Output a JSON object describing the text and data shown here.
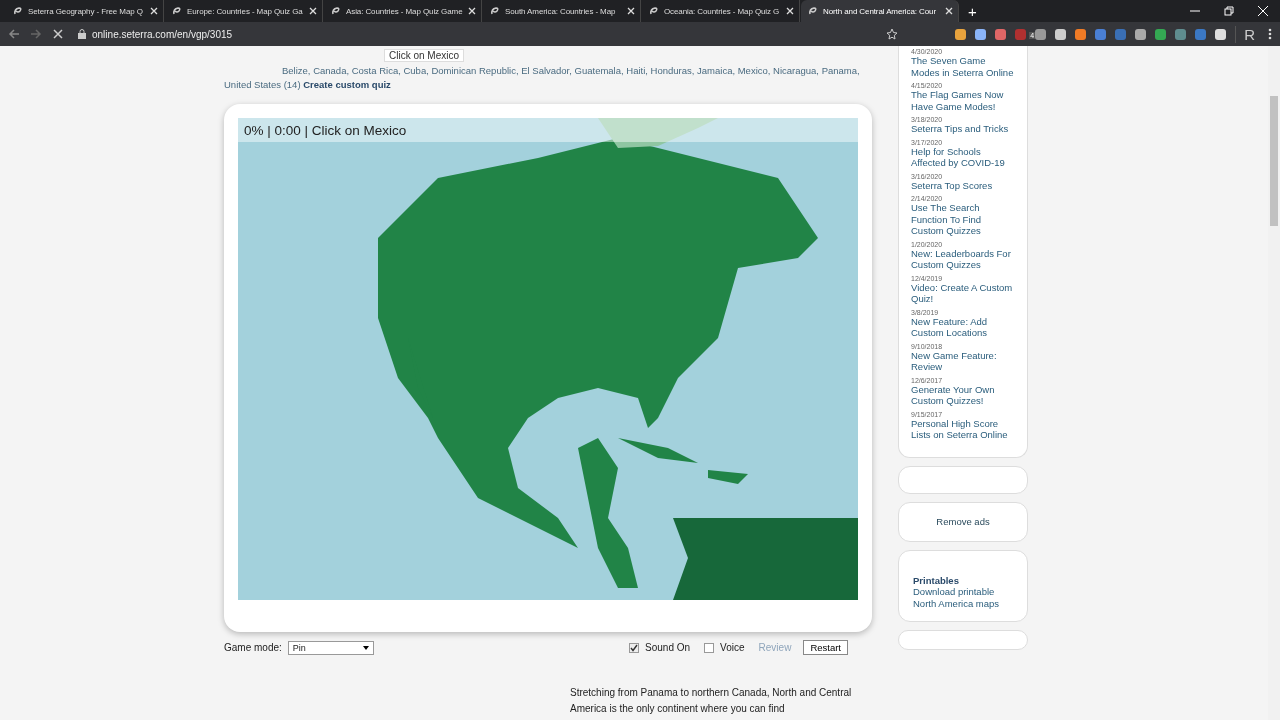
{
  "browser": {
    "tabs": [
      {
        "title": "Seterra Geography - Free Map Q",
        "selected": false
      },
      {
        "title": "Europe: Countries - Map Quiz Ga",
        "selected": false
      },
      {
        "title": "Asia: Countries - Map Quiz Game",
        "selected": false
      },
      {
        "title": "South America: Countries - Map",
        "selected": false
      },
      {
        "title": "Oceania: Countries - Map Quiz G",
        "selected": false
      },
      {
        "title": "North and Central America: Cour",
        "selected": true
      }
    ],
    "new_tab": "+",
    "url": "online.seterra.com/en/vgp/3015",
    "extension_badge": "4",
    "profile": "R"
  },
  "quiz": {
    "countries": "Belize, Canada, Costa Rica, Cuba, Dominican Republic, El Salvador, Guatemala, Haiti, Honduras, Jamaica, Mexico, Nicaragua, Panama, United States",
    "count": "(14)",
    "create_link": "Create custom quiz",
    "tooltip": "Click on Mexico",
    "status": "0% | 0:00 | Click on Mexico",
    "game_mode_label": "Game mode:",
    "game_mode": "Pin",
    "options": [
      {
        "label": "Sound On",
        "checked": true
      },
      {
        "label": "Voice",
        "checked": false
      }
    ],
    "review": {
      "label": "Review",
      "disabled": true
    },
    "restart": "Restart",
    "description": "Stretching from Panama to northern Canada, North and Central America is the only continent where you can find"
  },
  "news": [
    {
      "date": "4/30/2020",
      "title": "The Seven Game Modes in Seterra Online"
    },
    {
      "date": "4/15/2020",
      "title": "The Flag Games Now Have Game Modes!"
    },
    {
      "date": "3/18/2020",
      "title": "Seterra Tips and Tricks"
    },
    {
      "date": "3/17/2020",
      "title": "Help for Schools Affected by COVID-19"
    },
    {
      "date": "3/16/2020",
      "title": "Seterra Top Scores"
    },
    {
      "date": "2/14/2020",
      "title": "Use The Search Function To Find Custom Quizzes"
    },
    {
      "date": "1/20/2020",
      "title": "New: Leaderboards For Custom Quizzes"
    },
    {
      "date": "12/4/2019",
      "title": "Video: Create A Custom Quiz!"
    },
    {
      "date": "3/8/2019",
      "title": "New Feature: Add Custom Locations"
    },
    {
      "date": "9/10/2018",
      "title": "New Game Feature: Review"
    },
    {
      "date": "12/6/2017",
      "title": "Generate Your Own Custom Quizzes!"
    },
    {
      "date": "9/15/2017",
      "title": "Personal High Score Lists on Seterra Online"
    }
  ],
  "remove_ads": "Remove ads",
  "printables": {
    "title": "Printables",
    "text": "Download printable North America maps"
  }
}
